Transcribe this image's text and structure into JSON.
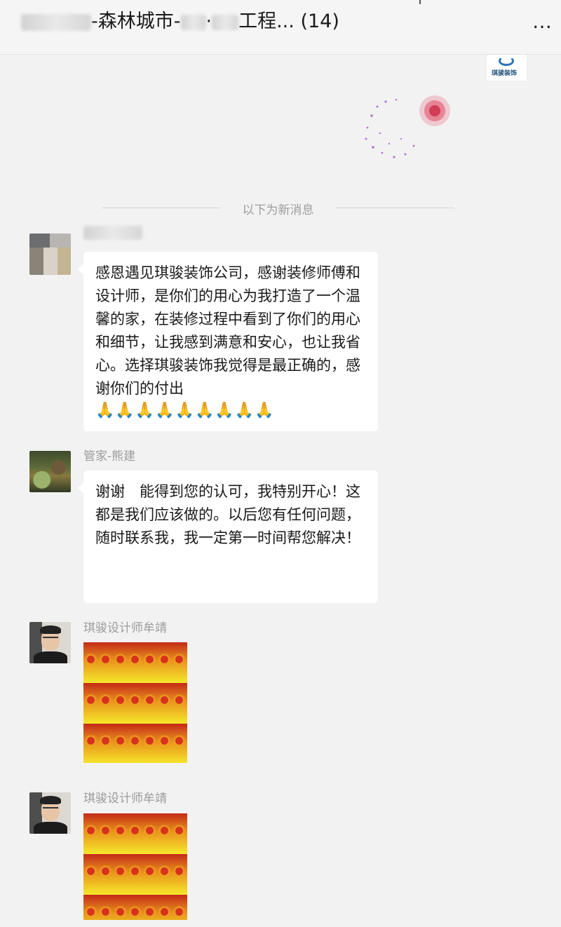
{
  "header": {
    "title_middle": "-森林城市-",
    "title_end": "工程...",
    "member_count": "(14)",
    "more_icon": "…"
  },
  "divider_text": "以下为新消息",
  "messages": [
    {
      "sender": "",
      "text": "感恩遇见琪骏装饰公司，感谢装修师傅和设计师，是你们的用心为我打造了一个温馨的家，在装修过程中看到了你们的用心和细节，让我感到满意和安心，也让我省心。选择琪骏装饰我觉得是最正确的，感谢你们的付出",
      "emoji": "🙏🙏🙏🙏🙏🙏🙏🙏🙏"
    },
    {
      "sender": "管家-熊建",
      "text": "谢谢　能得到您的认可，我特别开心！这都是我们应该做的。以后您有任何问题，随时联系我，我一定第一时间帮您解决！"
    },
    {
      "sender": "琪骏设计师牟靖",
      "type": "sticker"
    },
    {
      "sender": "琪骏设计师牟靖",
      "type": "sticker"
    }
  ],
  "logo_text": "琪骏装饰",
  "colors": {
    "background": "#f2f2f2",
    "bubble": "#ffffff",
    "muted_text": "#9c9c9c"
  }
}
